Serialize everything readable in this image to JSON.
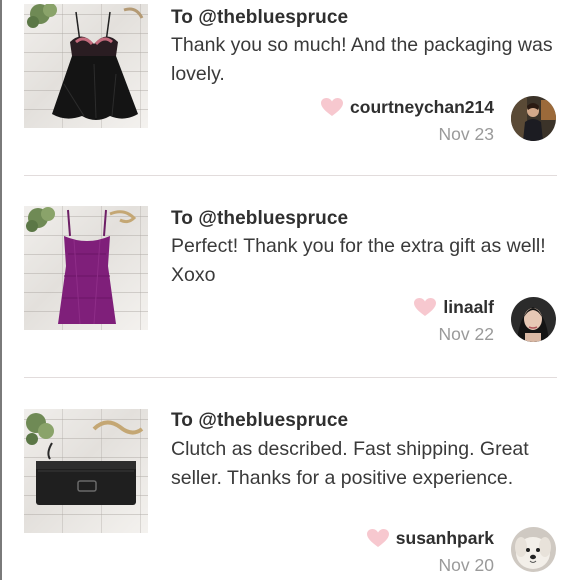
{
  "reviews": [
    {
      "recipient": "To @thebluespruce",
      "text": "Thank you so much! And the packaging was lovely.",
      "username": "courtneychan214",
      "date": "Nov 23",
      "item_icon": "black-lace-babydoll-image",
      "avatar_icon": "user-avatar"
    },
    {
      "recipient": "To @thebluespruce",
      "text": "Perfect! Thank you for the extra gift as well! Xoxo",
      "username": "linaalf",
      "date": "Nov 22",
      "item_icon": "purple-camisole-image",
      "avatar_icon": "user-avatar"
    },
    {
      "recipient": "To @thebluespruce",
      "text": "Clutch as described. Fast shipping. Great seller. Thanks for a positive experience.",
      "username": "susanhpark",
      "date": "Nov 20",
      "item_icon": "black-clutch-image",
      "avatar_icon": "dog-avatar"
    }
  ],
  "colors": {
    "heart": "#f7c8cf",
    "text": "#2f2f2f",
    "muted": "#9a9a9a",
    "divider": "#e2dcdc"
  }
}
